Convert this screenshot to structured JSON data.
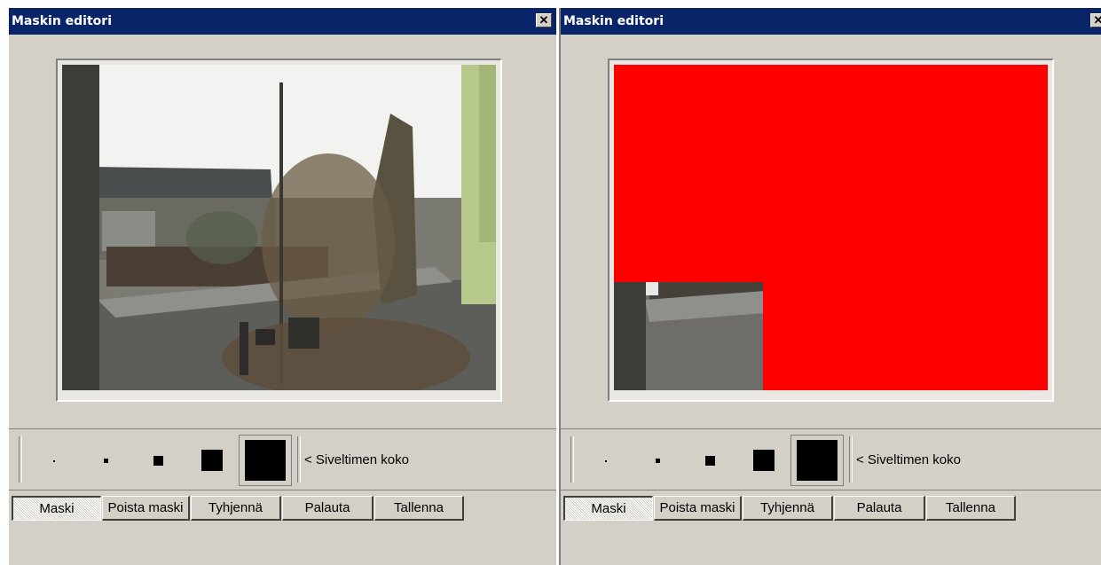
{
  "windows": [
    {
      "id": "left",
      "title": "Maskin editori",
      "close_glyph": "✕",
      "brush_label": "< Siveltimen koko",
      "buttons": [
        "Maski",
        "Poista maski",
        "Tyhjennä",
        "Palauta",
        "Tallenna"
      ],
      "active_button": "Maski",
      "mask": "none"
    },
    {
      "id": "right",
      "title": "Maskin editori",
      "close_glyph": "✕",
      "brush_label": "< Siveltimen koko",
      "buttons": [
        "Maski",
        "Poista maski",
        "Tyhjennä",
        "Palauta",
        "Tallenna"
      ],
      "active_button": "Maski",
      "mask": "red-fill-except-bottom-left"
    }
  ],
  "colors": {
    "titlebar": "#0a246a",
    "window_bg": "#d4d0c8",
    "mask": "#ff0000"
  },
  "icons": {
    "close": "close-icon",
    "brush_sizes": [
      "brush-size-1",
      "brush-size-2",
      "brush-size-3",
      "brush-size-4",
      "brush-size-5"
    ]
  }
}
